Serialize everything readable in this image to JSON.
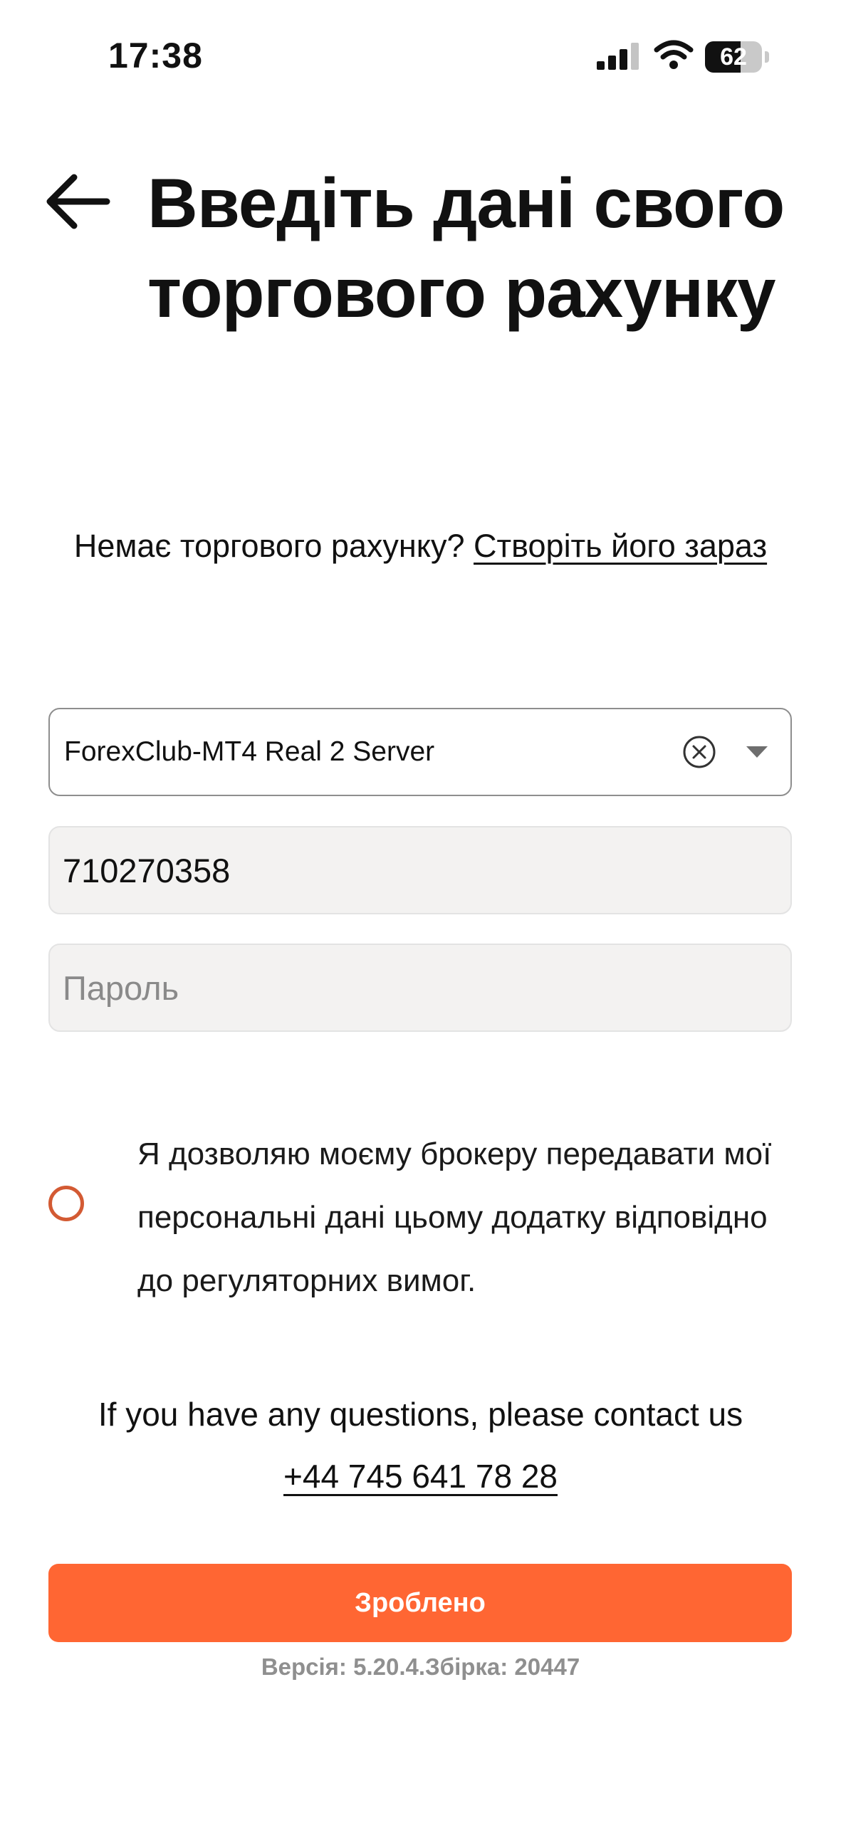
{
  "status_bar": {
    "time": "17:38",
    "battery_level": "62",
    "battery_fraction": 0.62
  },
  "header": {
    "title": "Введіть дані свого торгового рахунку"
  },
  "no_account": {
    "text": "Немає торгового рахунку? ",
    "link": "Створіть його зараз"
  },
  "form": {
    "server": {
      "value": "ForexClub-MT4 Real 2 Server"
    },
    "account_number": {
      "value": "710270358"
    },
    "password": {
      "placeholder": "Пароль",
      "value": ""
    }
  },
  "consent": {
    "text": "Я дозволяю моєму брокеру передавати мої персональні дані цьому додатку відповідно до регуляторних вимог.",
    "checked": false
  },
  "contact": {
    "text": "If you have any questions, please contact us",
    "phone": "+44 745 641 78 28"
  },
  "done_button": {
    "label": "Зроблено"
  },
  "version": {
    "text": "Версія: 5.20.4.Збірка: 20447"
  },
  "colors": {
    "accent": "#ff6633",
    "radio_border": "#d35a33",
    "field_background": "#f3f2f1"
  },
  "icons": {
    "back": "arrow-left-icon",
    "clear": "clear-circle-icon",
    "dropdown": "chevron-down-icon",
    "signal": "signal-icon",
    "wifi": "wifi-icon",
    "battery": "battery-icon"
  }
}
